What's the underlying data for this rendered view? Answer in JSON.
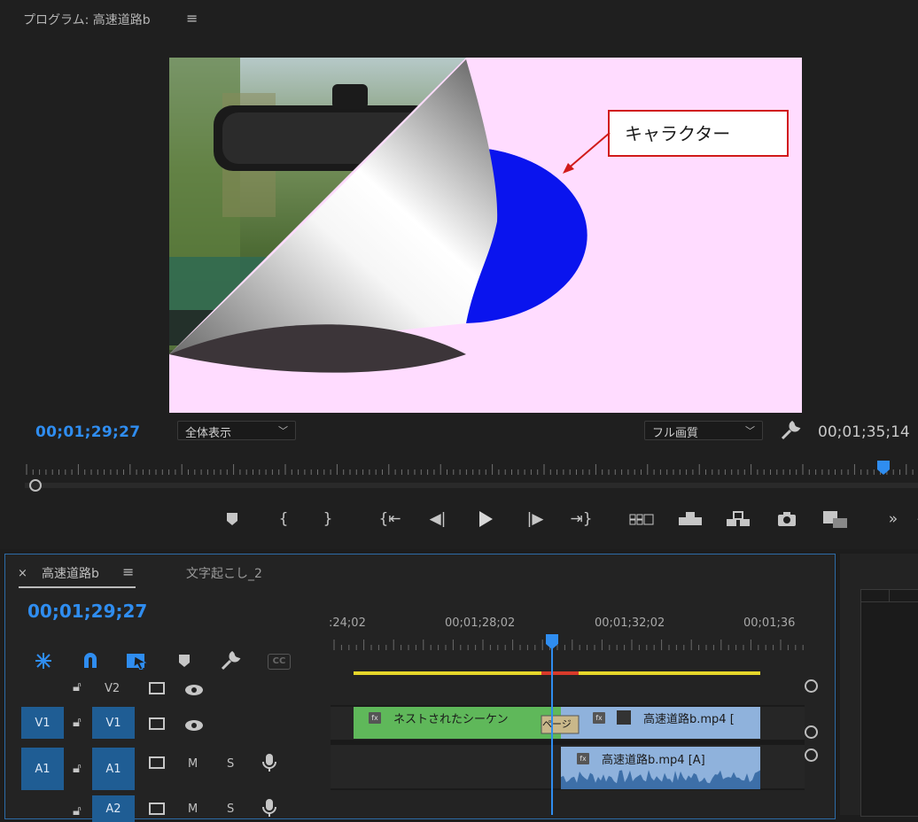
{
  "program": {
    "title": "プログラム: 高速道路b",
    "menu_icon": "hamburger-menu-icon",
    "callout_label": "キャラクター",
    "timecode_current": "00;01;29;27",
    "timecode_duration": "00;01;35;14",
    "zoom_select": "全体表示",
    "quality_select": "フル画質"
  },
  "transport": {
    "icons": [
      "marker-icon",
      "mark-in-icon",
      "mark-out-icon",
      "go-to-in-icon",
      "step-back-icon",
      "play-icon",
      "step-forward-icon",
      "go-to-out-icon",
      "compare-icon",
      "lift-icon",
      "extract-icon",
      "export-frame-icon",
      "insert-icon",
      "more-icon"
    ]
  },
  "sequence": {
    "tab_active": "高速道路b",
    "tab_inactive": "文字起こし_2",
    "close_glyph": "×",
    "timecode": "00;01;29;27",
    "ruler_labels": [
      ":24;02",
      "00;01;28;02",
      "00;01;32;02",
      "00;01;36"
    ],
    "tool_icons": [
      "snap-nest-icon",
      "magnet-icon",
      "linked-select-icon",
      "add-marker-icon",
      "settings-wrench-icon",
      "captions-icon"
    ],
    "cc_label": "CC",
    "tracks": {
      "v2_label": "V2",
      "v1_source": "V1",
      "v1_label": "V1",
      "a1_source": "A1",
      "a1_label": "A1",
      "a2_label": "A2",
      "mute_label": "M",
      "solo_label": "S"
    },
    "clips": {
      "nested": "ネストされたシーケン",
      "transition": "ページ",
      "video": "高速道路b.mp4 [",
      "audio": "高速道路b.mp4 [A]",
      "fx": "fx"
    }
  },
  "colors": {
    "accent_blue": "#2f8df0",
    "nested_clip": "#5fb85a",
    "video_clip": "#8fb2dc",
    "audio_clip": "#8fb2dc",
    "work_area": "#e6d62a",
    "render_red": "#d83a2a",
    "viewer_bg": "#ffdcff",
    "character_blue": "#0a14ee",
    "callout_red": "#d11a1a"
  }
}
